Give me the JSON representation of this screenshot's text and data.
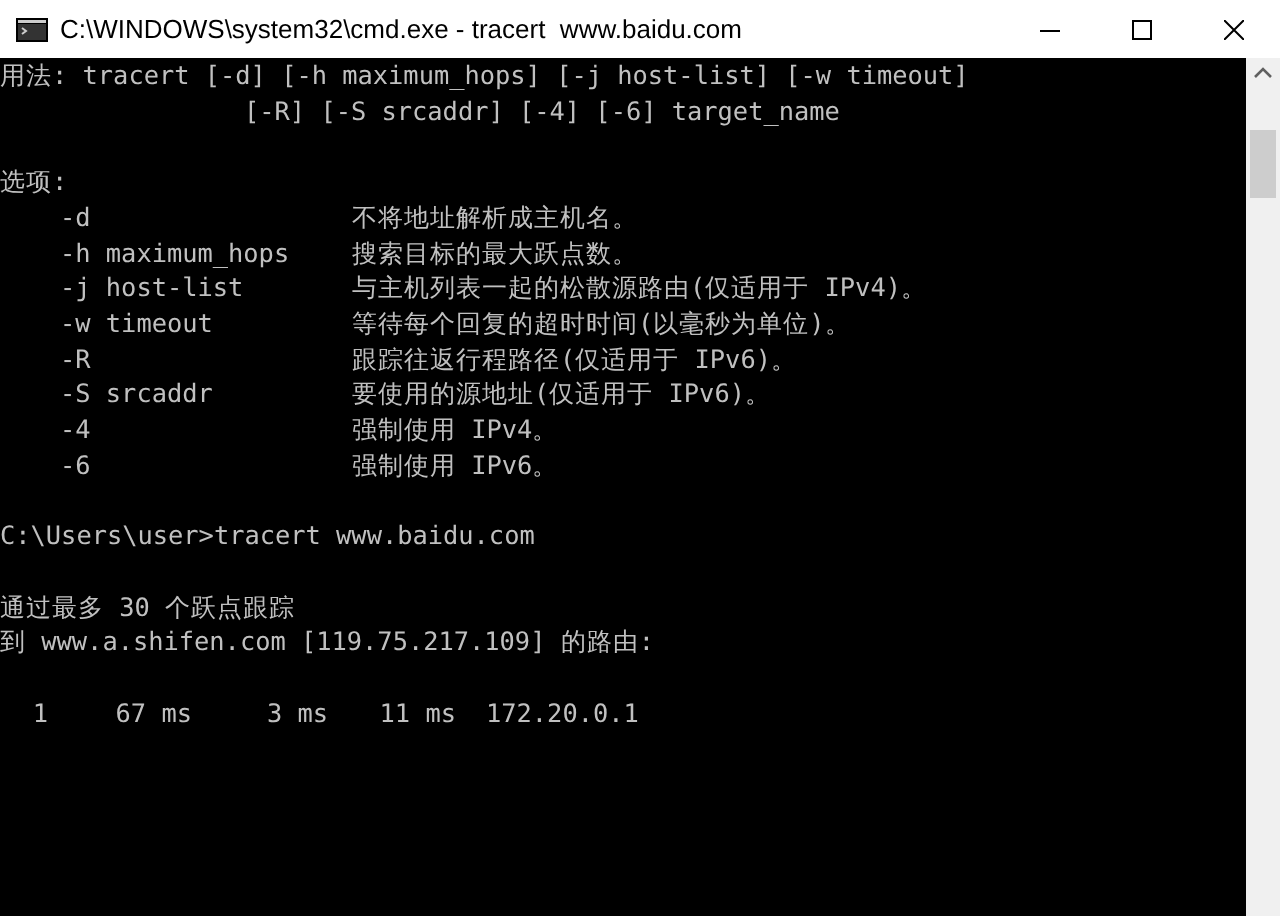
{
  "window": {
    "title": "C:\\WINDOWS\\system32\\cmd.exe - tracert  www.baidu.com"
  },
  "usage": [
    "用法: tracert [-d] [-h maximum_hops] [-j host-list] [-w timeout]",
    "[-R] [-S srcaddr] [-4] [-6] target_name"
  ],
  "options_heading": "选项:",
  "options": [
    {
      "flag": "-d",
      "description": "不将地址解析成主机名。"
    },
    {
      "flag": "-h maximum_hops",
      "description": "搜索目标的最大跃点数。"
    },
    {
      "flag": "-j host-list",
      "description": "与主机列表一起的松散源路由(仅适用于 IPv4)。"
    },
    {
      "flag": "-w timeout",
      "description": "等待每个回复的超时时间(以毫秒为单位)。"
    },
    {
      "flag": "-R",
      "description": "跟踪往返行程路径(仅适用于 IPv6)。"
    },
    {
      "flag": "-S srcaddr",
      "description": "要使用的源地址(仅适用于 IPv6)。"
    },
    {
      "flag": "-4",
      "description": "强制使用 IPv4。"
    },
    {
      "flag": "-6",
      "description": "强制使用 IPv6。"
    }
  ],
  "prompt": "C:\\Users\\user>tracert www.baidu.com",
  "trace_header": [
    "通过最多 30 个跃点跟踪",
    "到 www.a.shifen.com [119.75.217.109] 的路由:"
  ],
  "hops": [
    {
      "hop": "1",
      "times": [
        "67 ms",
        "3 ms",
        "11 ms"
      ],
      "address": "172.20.0.1"
    }
  ]
}
